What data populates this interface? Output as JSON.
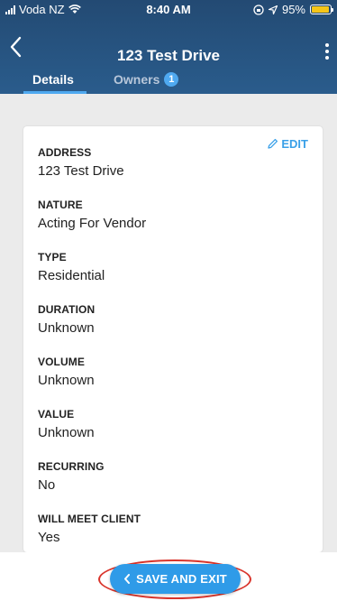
{
  "status_bar": {
    "carrier": "Voda NZ",
    "time": "8:40 AM",
    "battery_percent": "95%",
    "battery_level": 0.95
  },
  "header": {
    "title": "123 Test Drive",
    "back_icon": "chevron-left-icon",
    "menu_icon": "kebab-menu-icon"
  },
  "tabs": [
    {
      "label": "Details",
      "active": true
    },
    {
      "label": "Owners",
      "badge": "1",
      "active": false
    }
  ],
  "card": {
    "edit_label": "EDIT",
    "fields": [
      {
        "label": "ADDRESS",
        "value": "123 Test Drive"
      },
      {
        "label": "NATURE",
        "value": "Acting For Vendor"
      },
      {
        "label": "TYPE",
        "value": "Residential"
      },
      {
        "label": "DURATION",
        "value": "Unknown"
      },
      {
        "label": "VOLUME",
        "value": "Unknown"
      },
      {
        "label": "VALUE",
        "value": "Unknown"
      },
      {
        "label": "RECURRING",
        "value": "No"
      },
      {
        "label": "WILL MEET CLIENT",
        "value": "Yes"
      }
    ]
  },
  "footer": {
    "save_exit_label": "SAVE AND EXIT"
  },
  "colors": {
    "header": "#2a5c8c",
    "accent": "#2f9be8",
    "annotation": "#d9342b"
  }
}
